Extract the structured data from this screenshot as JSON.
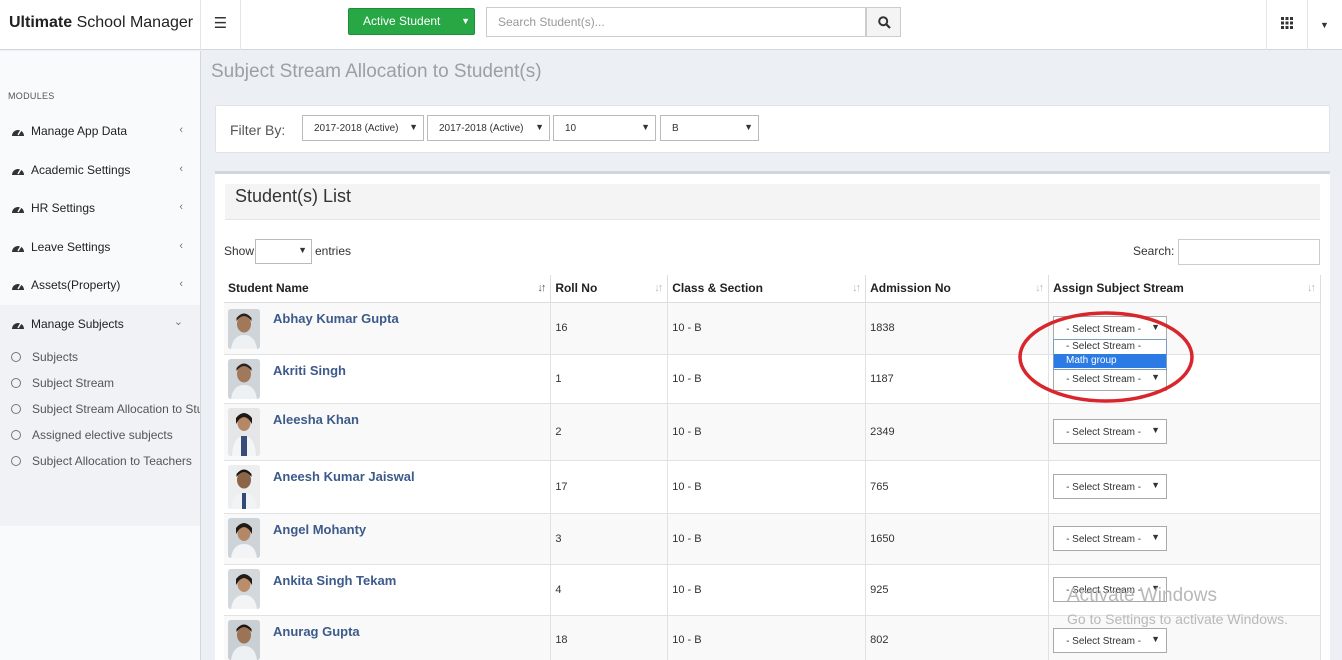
{
  "header": {
    "brand_bold": "Ultimate",
    "brand_rest": " School Manager",
    "active_button": "Active Student",
    "search_placeholder": "Search Student(s)..."
  },
  "sidebar": {
    "section_label": "MODULES",
    "items": [
      {
        "label": "Manage App Data"
      },
      {
        "label": "Academic Settings"
      },
      {
        "label": "HR Settings"
      },
      {
        "label": "Leave Settings"
      },
      {
        "label": "Assets(Property)"
      },
      {
        "label": "Manage Subjects"
      }
    ],
    "subitems": [
      {
        "label": "Subjects"
      },
      {
        "label": "Subject Stream"
      },
      {
        "label": "Subject Stream Allocation to Students"
      },
      {
        "label": "Assigned elective subjects"
      },
      {
        "label": "Subject Allocation to Teachers"
      }
    ]
  },
  "page": {
    "title": "Subject Stream Allocation to Student(s)"
  },
  "filter": {
    "label": "Filter By:",
    "session": "2017-2018 (Active)",
    "session2": "2017-2018 (Active)",
    "class": "10",
    "section": "B"
  },
  "list": {
    "heading": "Student(s) List",
    "show_label": "Show",
    "entries_label": "entries",
    "search_label": "Search:",
    "columns": [
      "Student Name",
      "Roll No",
      "Class & Section",
      "Admission No",
      "Assign Subject Stream"
    ],
    "select_placeholder": "- Select Stream -",
    "rows": [
      {
        "name": "Abhay Kumar Gupta",
        "roll": "16",
        "class_section": "10 - B",
        "admission": "1838"
      },
      {
        "name": "Akriti Singh",
        "roll": "1",
        "class_section": "10 - B",
        "admission": "1187"
      },
      {
        "name": "Aleesha Khan",
        "roll": "2",
        "class_section": "10 - B",
        "admission": "2349"
      },
      {
        "name": "Aneesh Kumar Jaiswal",
        "roll": "17",
        "class_section": "10 - B",
        "admission": "765"
      },
      {
        "name": "Angel Mohanty",
        "roll": "3",
        "class_section": "10 - B",
        "admission": "1650"
      },
      {
        "name": "Ankita Singh Tekam",
        "roll": "4",
        "class_section": "10 - B",
        "admission": "925"
      },
      {
        "name": "Anurag Gupta",
        "roll": "18",
        "class_section": "10 - B",
        "admission": "802"
      }
    ],
    "dropdown_options": [
      "- Select Stream -",
      "Math group"
    ],
    "dropdown_selected": "Math group"
  },
  "annotation": {
    "color": "#d9262c"
  },
  "watermark": {
    "line1": "Activate Windows",
    "line2": "Go to Settings to activate Windows."
  },
  "colors": {
    "primary_button": "#28a745",
    "link": "#3c5a8a",
    "selected_option": "#2c7be5"
  }
}
